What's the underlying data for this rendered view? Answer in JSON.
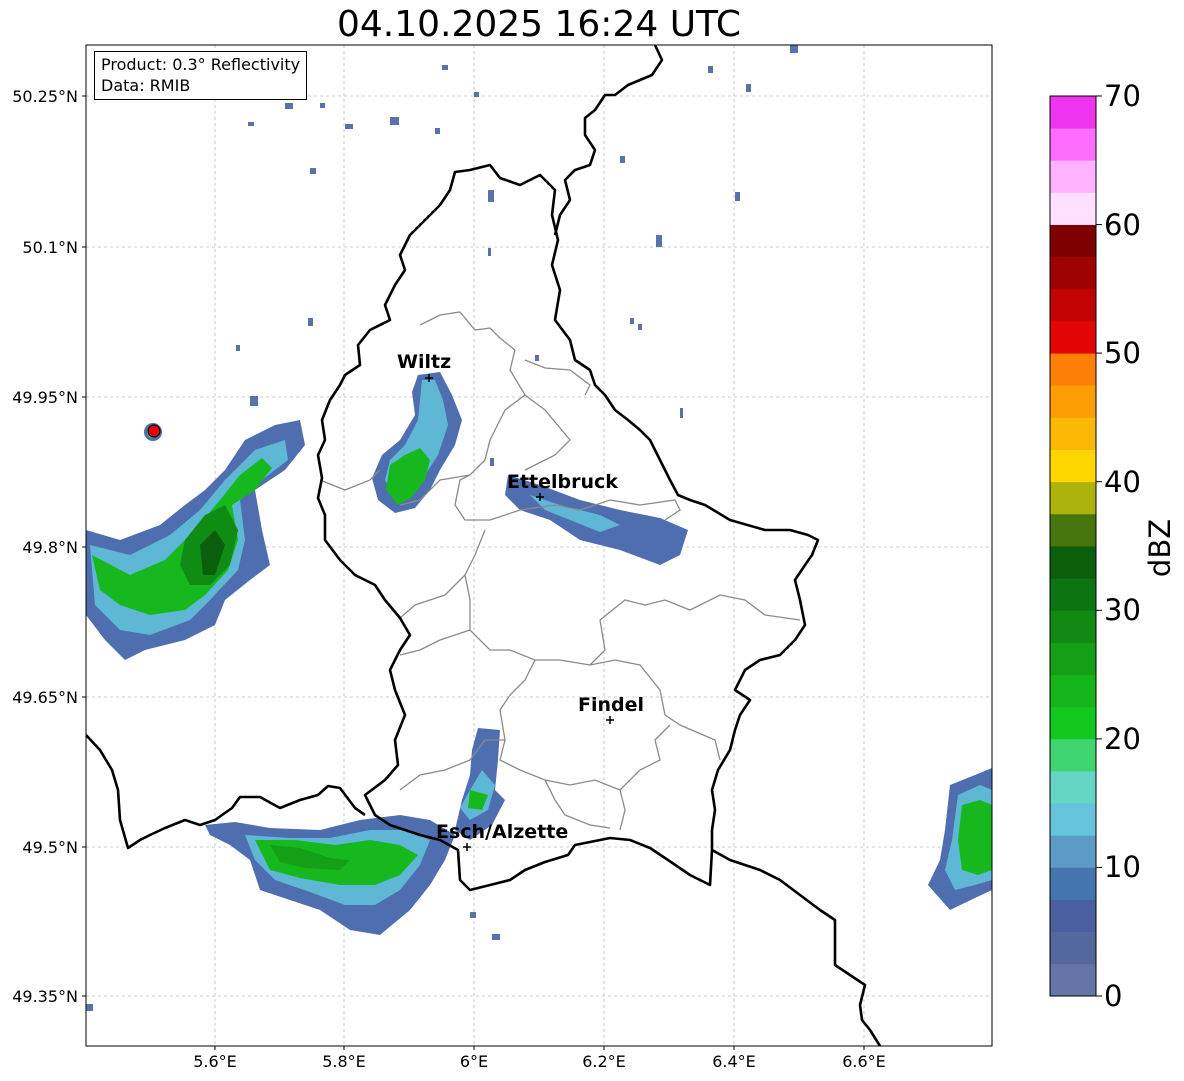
{
  "title": "04.10.2025 16:24 UTC",
  "info": {
    "product": "Product: 0.3° Reflectivity",
    "data": "Data: RMIB"
  },
  "axes": {
    "lon_ticks": [
      "5.6°E",
      "5.8°E",
      "6°E",
      "6.2°E",
      "6.4°E",
      "6.6°E"
    ],
    "lat_ticks": [
      "50.25°N",
      "50.1°N",
      "49.95°N",
      "49.8°N",
      "49.65°N",
      "49.5°N",
      "49.35°N"
    ]
  },
  "cities": [
    {
      "name": "Wiltz"
    },
    {
      "name": "Ettelbruck"
    },
    {
      "name": "Findel"
    },
    {
      "name": "Esch/Alzette"
    }
  ],
  "colorbar": {
    "label": "dBZ",
    "ticks": [
      "0",
      "10",
      "20",
      "30",
      "40",
      "50",
      "60",
      "70"
    ],
    "colors": [
      "#6575a8",
      "#55689e",
      "#4a5fa0",
      "#4575ae",
      "#5b9bc6",
      "#66c3dc",
      "#64d6c4",
      "#3fd46f",
      "#12c81c",
      "#13b51a",
      "#139f16",
      "#118912",
      "#0c7410",
      "#0a5e0c",
      "#47760e",
      "#acb30a",
      "#ffd700",
      "#fcb806",
      "#fc9d05",
      "#fd7f04",
      "#e10505",
      "#c10303",
      "#9f0202",
      "#7f0000",
      "#ffe1ff",
      "#ffb2ff",
      "#ff6dff",
      "#ef34ef"
    ]
  }
}
